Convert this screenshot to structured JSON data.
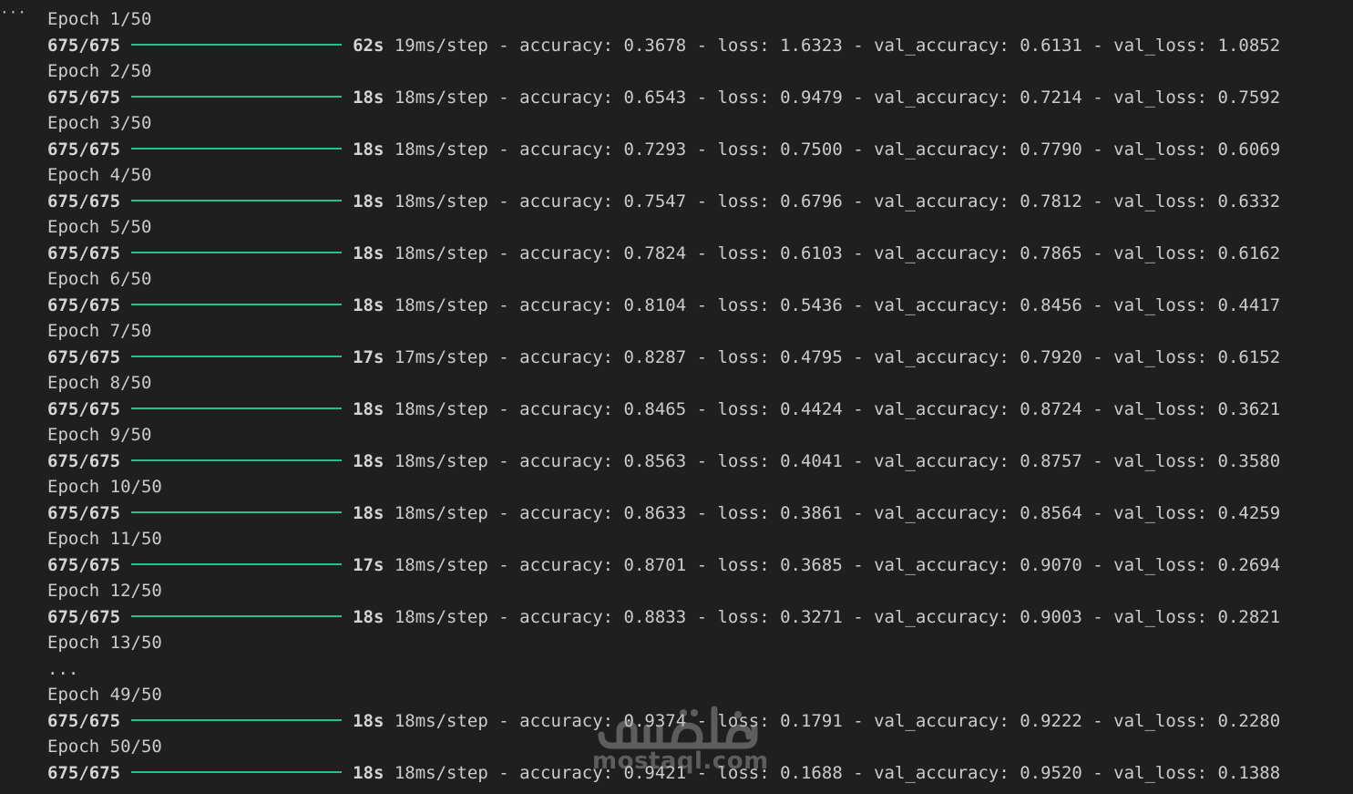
{
  "cell": {
    "indicator": "···"
  },
  "colors": {
    "progress_bar": "#23c28a",
    "background": "#1f1f1f",
    "text": "#cccccc"
  },
  "lines": [
    {
      "type": "epoch",
      "text": "Epoch 1/50"
    },
    {
      "type": "step",
      "progress": "675/675",
      "time": "62s",
      "rate": "19ms/step",
      "metrics": "- accuracy: 0.3678 - loss: 1.6323 - val_accuracy: 0.6131 - val_loss: 1.0852"
    },
    {
      "type": "epoch",
      "text": "Epoch 2/50"
    },
    {
      "type": "step",
      "progress": "675/675",
      "time": "18s",
      "rate": "18ms/step",
      "metrics": "- accuracy: 0.6543 - loss: 0.9479 - val_accuracy: 0.7214 - val_loss: 0.7592"
    },
    {
      "type": "epoch",
      "text": "Epoch 3/50"
    },
    {
      "type": "step",
      "progress": "675/675",
      "time": "18s",
      "rate": "18ms/step",
      "metrics": "- accuracy: 0.7293 - loss: 0.7500 - val_accuracy: 0.7790 - val_loss: 0.6069"
    },
    {
      "type": "epoch",
      "text": "Epoch 4/50"
    },
    {
      "type": "step",
      "progress": "675/675",
      "time": "18s",
      "rate": "18ms/step",
      "metrics": "- accuracy: 0.7547 - loss: 0.6796 - val_accuracy: 0.7812 - val_loss: 0.6332"
    },
    {
      "type": "epoch",
      "text": "Epoch 5/50"
    },
    {
      "type": "step",
      "progress": "675/675",
      "time": "18s",
      "rate": "18ms/step",
      "metrics": "- accuracy: 0.7824 - loss: 0.6103 - val_accuracy: 0.7865 - val_loss: 0.6162"
    },
    {
      "type": "epoch",
      "text": "Epoch 6/50"
    },
    {
      "type": "step",
      "progress": "675/675",
      "time": "18s",
      "rate": "18ms/step",
      "metrics": "- accuracy: 0.8104 - loss: 0.5436 - val_accuracy: 0.8456 - val_loss: 0.4417"
    },
    {
      "type": "epoch",
      "text": "Epoch 7/50"
    },
    {
      "type": "step",
      "progress": "675/675",
      "time": "17s",
      "rate": "17ms/step",
      "metrics": "- accuracy: 0.8287 - loss: 0.4795 - val_accuracy: 0.7920 - val_loss: 0.6152"
    },
    {
      "type": "epoch",
      "text": "Epoch 8/50"
    },
    {
      "type": "step",
      "progress": "675/675",
      "time": "18s",
      "rate": "18ms/step",
      "metrics": "- accuracy: 0.8465 - loss: 0.4424 - val_accuracy: 0.8724 - val_loss: 0.3621"
    },
    {
      "type": "epoch",
      "text": "Epoch 9/50"
    },
    {
      "type": "step",
      "progress": "675/675",
      "time": "18s",
      "rate": "18ms/step",
      "metrics": "- accuracy: 0.8563 - loss: 0.4041 - val_accuracy: 0.8757 - val_loss: 0.3580"
    },
    {
      "type": "epoch",
      "text": "Epoch 10/50"
    },
    {
      "type": "step",
      "progress": "675/675",
      "time": "18s",
      "rate": "18ms/step",
      "metrics": "- accuracy: 0.8633 - loss: 0.3861 - val_accuracy: 0.8564 - val_loss: 0.4259"
    },
    {
      "type": "epoch",
      "text": "Epoch 11/50"
    },
    {
      "type": "step",
      "progress": "675/675",
      "time": "17s",
      "rate": "18ms/step",
      "metrics": "- accuracy: 0.8701 - loss: 0.3685 - val_accuracy: 0.9070 - val_loss: 0.2694"
    },
    {
      "type": "epoch",
      "text": "Epoch 12/50"
    },
    {
      "type": "step",
      "progress": "675/675",
      "time": "18s",
      "rate": "18ms/step",
      "metrics": "- accuracy: 0.8833 - loss: 0.3271 - val_accuracy: 0.9003 - val_loss: 0.2821"
    },
    {
      "type": "epoch",
      "text": "Epoch 13/50"
    },
    {
      "type": "epoch",
      "text": "..."
    },
    {
      "type": "epoch",
      "text": "Epoch 49/50"
    },
    {
      "type": "step",
      "progress": "675/675",
      "time": "18s",
      "rate": "18ms/step",
      "metrics": "- accuracy: 0.9374 - loss: 0.1791 - val_accuracy: 0.9222 - val_loss: 0.2280"
    },
    {
      "type": "epoch",
      "text": "Epoch 50/50"
    },
    {
      "type": "step",
      "progress": "675/675",
      "time": "18s",
      "rate": "18ms/step",
      "metrics": "- accuracy: 0.9421 - loss: 0.1688 - val_accuracy: 0.9520 - val_loss: 0.1388"
    }
  ],
  "watermark": {
    "arabic": "مستقل",
    "latin": "mostaql.com"
  }
}
